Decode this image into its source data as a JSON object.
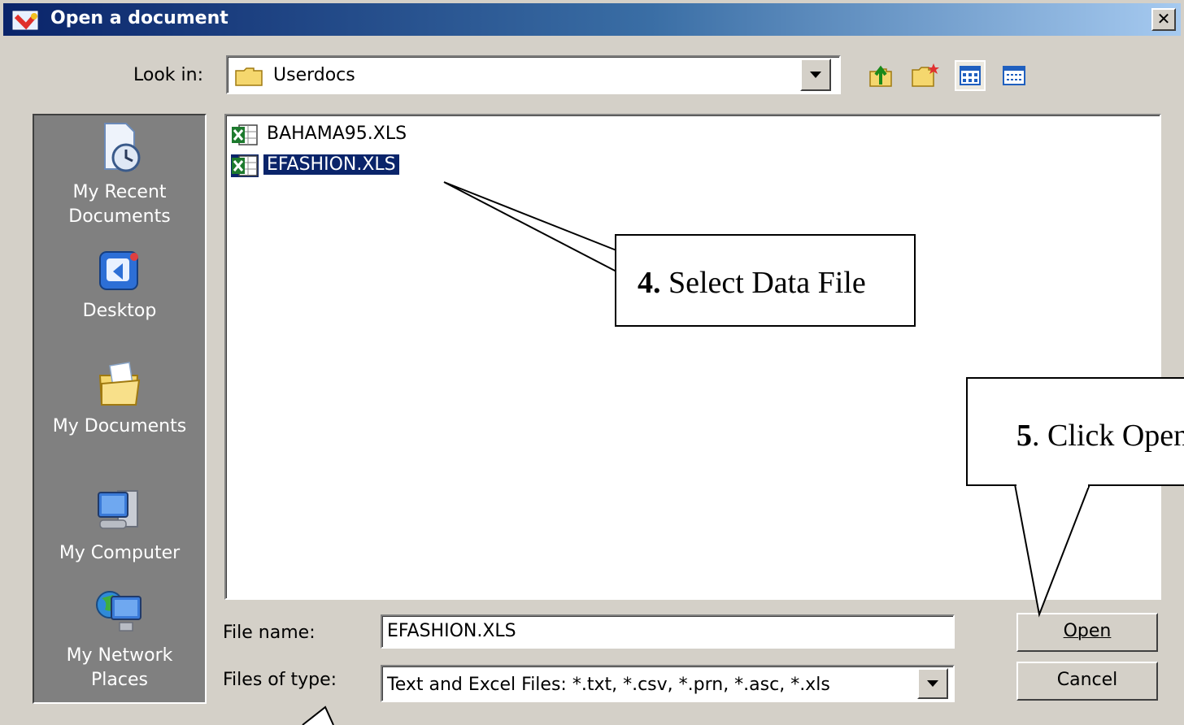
{
  "window": {
    "title": "Open a document",
    "close_glyph": "✕"
  },
  "look_in": {
    "label": "Look in:",
    "value": "Userdocs"
  },
  "toolbar": {
    "icons": [
      "up-folder-icon",
      "new-folder-icon",
      "list-view-icon",
      "details-view-icon"
    ]
  },
  "places": [
    {
      "label": "My Recent Documents",
      "icon": "recent-documents-icon"
    },
    {
      "label": "Desktop",
      "icon": "desktop-icon"
    },
    {
      "label": "My Documents",
      "icon": "my-documents-icon"
    },
    {
      "label": "My Computer",
      "icon": "my-computer-icon"
    },
    {
      "label": "My Network Places",
      "icon": "network-places-icon"
    }
  ],
  "files": [
    {
      "name": "BAHAMA95.XLS",
      "selected": false
    },
    {
      "name": "EFASHION.XLS",
      "selected": true
    }
  ],
  "file_name": {
    "label": "File name:",
    "value": "EFASHION.XLS"
  },
  "files_of_type": {
    "label": "Files of type:",
    "value": "Text and Excel Files: *.txt, *.csv, *.prn, *.asc, *.xls"
  },
  "buttons": {
    "open": "Open",
    "cancel": "Cancel"
  },
  "callouts": {
    "select": {
      "step": "4.",
      "text": " Select Data File"
    },
    "open": {
      "step": "5",
      "text": ".  Click Open"
    }
  },
  "colors": {
    "titlebar": "#0a246a",
    "dialog": "#d4d0c8",
    "selection": "#0a246a"
  }
}
